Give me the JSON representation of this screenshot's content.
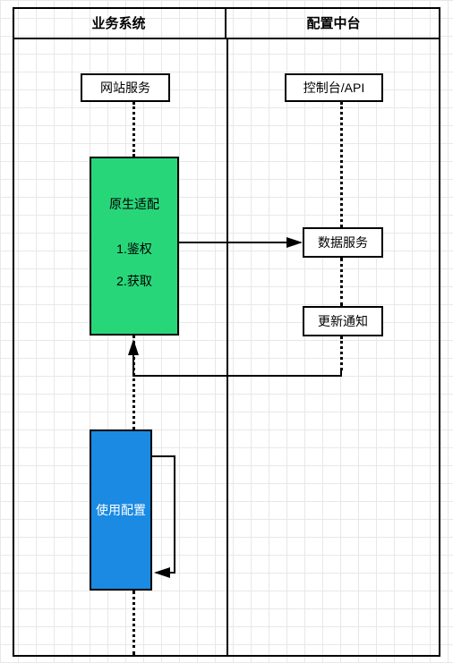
{
  "columns": {
    "left": {
      "title": "业务系统"
    },
    "right": {
      "title": "配置中台"
    }
  },
  "nodes": {
    "web_service": {
      "label": "网站服务"
    },
    "console_api": {
      "label": "控制台/API"
    },
    "native_adapter": {
      "title": "原生适配",
      "step1": "1.鉴权",
      "step2": "2.获取"
    },
    "data_service": {
      "label": "数据服务"
    },
    "update_notify": {
      "label": "更新通知"
    },
    "use_config": {
      "label": "使用配置"
    }
  }
}
